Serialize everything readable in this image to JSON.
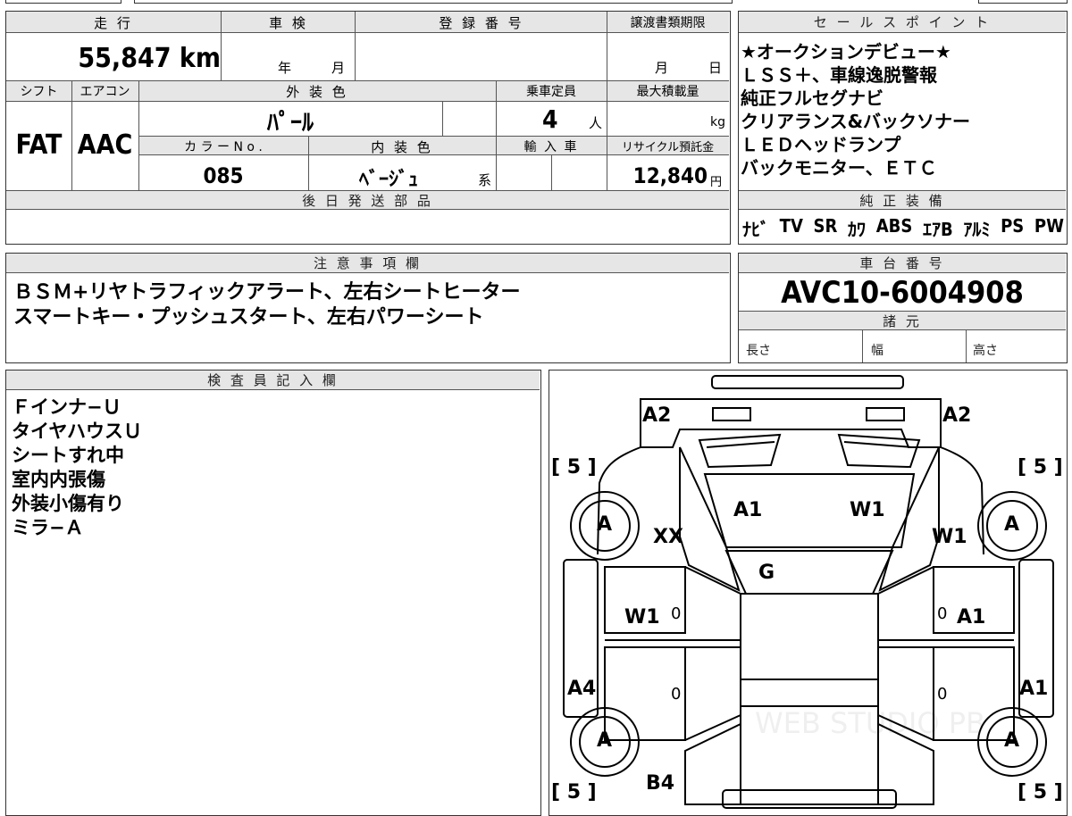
{
  "vehicle": {
    "headers": {
      "mileage": "走 行",
      "inspection": "車 検",
      "registration": "登 録 番 号",
      "transfer_deadline": "譲渡書類期限",
      "shift": "シフト",
      "aircon": "エアコン",
      "exterior_color": "外 装 色",
      "capacity": "乗車定員",
      "max_load": "最大積載量",
      "color_no": "カ ラ ー N o .",
      "interior_color": "内 装 色",
      "import": "輸 入 車",
      "recycle_fee": "リサイクル預託金",
      "later_parts": "後 日 発 送 部 品"
    },
    "mileage": "55,847",
    "mileage_unit": "km",
    "inspection_year_unit": "年",
    "inspection_month_unit": "月",
    "transfer_month_unit": "月",
    "transfer_day_unit": "日",
    "shift": "FAT",
    "aircon": "AAC",
    "exterior_color": "ﾊﾟｰﾙ",
    "capacity": "4",
    "capacity_unit": "人",
    "max_load_unit": "kg",
    "color_no": "085",
    "interior_color": "ﾍﾞｰｼﾞｭ",
    "interior_color_suffix": "系",
    "recycle_fee": "12,840",
    "recycle_fee_unit": "円"
  },
  "sales_points": {
    "header": "セ ー ル ス ポ イ ン ト",
    "lines": [
      "★オークションデビュー★",
      "ＬＳＳ＋、車線逸脱警報",
      "純正フルセグナビ",
      "クリアランス&バックソナー",
      "ＬＥＤヘッドランプ",
      "バックモニター、ＥＴＣ"
    ]
  },
  "equipment": {
    "header": "純 正 装 備",
    "items": [
      "ﾅﾋﾞ",
      "TV",
      "SR",
      "ｶﾜ",
      "ABS",
      "ｴｱB",
      "ｱﾙﾐ",
      "PS",
      "PW"
    ]
  },
  "notes": {
    "header": "注 意 事 項 欄",
    "lines": [
      "ＢＳＭ+リヤトラフィックアラート、左右シートヒーター",
      "スマートキー・プッシュスタート、左右パワーシート"
    ]
  },
  "chassis": {
    "header": "車 台 番 号",
    "number": "AVC10-6004908"
  },
  "specs": {
    "header": "諸 元",
    "length": "長さ",
    "width": "幅",
    "height": "高さ"
  },
  "inspector": {
    "header": "検 査 員 記 入 欄",
    "lines": [
      "Ｆインナ−Ｕ",
      "タイヤハウスＵ",
      "シートすれ中",
      "室内内張傷",
      "外装小傷有り",
      "ミラ−Ａ"
    ]
  },
  "damage_map": {
    "tread_left_top": "[ 5 ]",
    "tread_right_top": "[ 5 ]",
    "tread_left_bottom": "[ 5 ]",
    "tread_right_bottom": "[ 5 ]",
    "bumper_left": "A2",
    "bumper_right": "A2",
    "hood_left": "A1",
    "hood_right": "W1",
    "front_fender_left": "XX",
    "front_fender_right": "W1",
    "windshield": "G",
    "front_door_left": "W1",
    "front_door_right": "A1",
    "rear_quarter_left": "A4",
    "rear_quarter_right": "A1",
    "rear_left": "B4",
    "wheel_fl": "A",
    "wheel_fr": "A",
    "wheel_rl": "A",
    "wheel_rr": "A",
    "zero_marks": [
      "0",
      "0",
      "0",
      "0"
    ],
    "watermark": "WEB STUDIO PB"
  }
}
